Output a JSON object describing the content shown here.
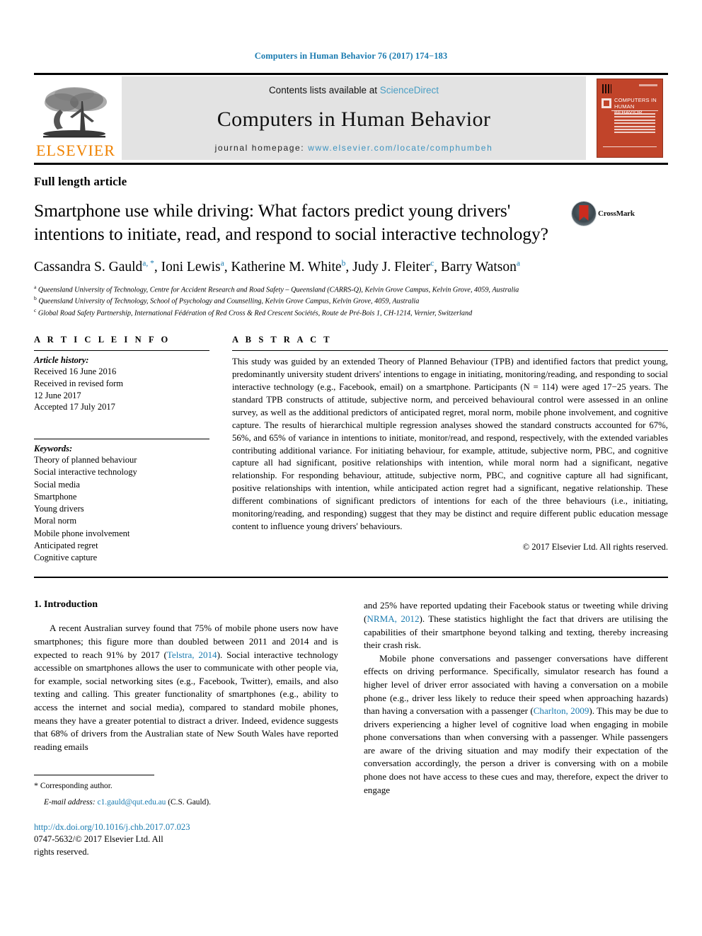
{
  "running_head": "Computers in Human Behavior 76 (2017) 174−183",
  "banner": {
    "publisher_logo_text": "ELSEVIER",
    "contents_prefix": "Contents lists available at ",
    "contents_link": "ScienceDirect",
    "journal_name": "Computers in Human Behavior",
    "homepage_prefix": "journal homepage: ",
    "homepage_url": "www.elsevier.com/locate/comphumbeh",
    "cover_title": "COMPUTERS IN HUMAN BEHAVIOR",
    "cover_color": "#c1442a",
    "link_color": "#3e93bf"
  },
  "article": {
    "type": "Full length article",
    "title": "Smartphone use while driving: What factors predict young drivers' intentions to initiate, read, and respond to social interactive technology?",
    "crossmark_label": "CrossMark"
  },
  "authors": {
    "line": [
      {
        "name": "Cassandra S. Gauld",
        "marks": "a, *"
      },
      {
        "name": "Ioni Lewis",
        "marks": "a"
      },
      {
        "name": "Katherine M. White",
        "marks": "b"
      },
      {
        "name": "Judy J. Fleiter",
        "marks": "c"
      },
      {
        "name": "Barry Watson",
        "marks": "a"
      }
    ],
    "affiliations": [
      {
        "mark": "a",
        "text": "Queensland University of Technology, Centre for Accident Research and Road Safety – Queensland (CARRS-Q), Kelvin Grove Campus, Kelvin Grove, 4059, Australia"
      },
      {
        "mark": "b",
        "text": "Queensland University of Technology, School of Psychology and Counselling, Kelvin Grove Campus, Kelvin Grove, 4059, Australia"
      },
      {
        "mark": "c",
        "text": "Global Road Safety Partnership, International Fédération of Red Cross & Red Crescent Sociétés, Route de Pré-Bois 1, CH-1214, Vernier, Switzerland"
      }
    ]
  },
  "article_info": {
    "heading": "A R T I C L E  I N F O",
    "history_label": "Article history:",
    "history": [
      "Received 16 June 2016",
      "Received in revised form",
      "12 June 2017",
      "Accepted 17 July 2017"
    ],
    "keywords_label": "Keywords:",
    "keywords": [
      "Theory of planned behaviour",
      "Social interactive technology",
      "Social media",
      "Smartphone",
      "Young drivers",
      "Moral norm",
      "Mobile phone involvement",
      "Anticipated regret",
      "Cognitive capture"
    ]
  },
  "abstract": {
    "heading": "A B S T R A C T",
    "text": "This study was guided by an extended Theory of Planned Behaviour (TPB) and identified factors that predict young, predominantly university student drivers' intentions to engage in initiating, monitoring/reading, and responding to social interactive technology (e.g., Facebook, email) on a smartphone. Participants (N = 114) were aged 17−25 years. The standard TPB constructs of attitude, subjective norm, and perceived behavioural control were assessed in an online survey, as well as the additional predictors of anticipated regret, moral norm, mobile phone involvement, and cognitive capture. The results of hierarchical multiple regression analyses showed the standard constructs accounted for 67%, 56%, and 65% of variance in intentions to initiate, monitor/read, and respond, respectively, with the extended variables contributing additional variance. For initiating behaviour, for example, attitude, subjective norm, PBC, and cognitive capture all had significant, positive relationships with intention, while moral norm had a significant, negative relationship. For responding behaviour, attitude, subjective norm, PBC, and cognitive capture all had significant, positive relationships with intention, while anticipated action regret had a significant, negative relationship. These different combinations of significant predictors of intentions for each of the three behaviours (i.e., initiating, monitoring/reading, and responding) suggest that they may be distinct and require different public education message content to influence young drivers' behaviours.",
    "copyright": "© 2017 Elsevier Ltd. All rights reserved."
  },
  "body": {
    "section_title": "1. Introduction",
    "left_para_1_a": "A recent Australian survey found that 75% of mobile phone users now have smartphones; this figure more than doubled between 2011 and 2014 and is expected to reach 91% by 2017 (",
    "left_para_1_ref": "Telstra, 2014",
    "left_para_1_b": "). Social interactive technology accessible on smartphones allows the user to communicate with other people via, for example, social networking sites (e.g., Facebook, Twitter), emails, and also texting and calling. This greater functionality of smartphones (e.g., ability to access the internet and social media), compared to standard mobile phones, means they have a greater potential to distract a driver. Indeed, evidence suggests that 68% of drivers from the Australian state of New South Wales have reported reading emails",
    "right_para_1_a": "and 25% have reported updating their Facebook status or tweeting while driving (",
    "right_para_1_ref": "NRMA, 2012",
    "right_para_1_b": "). These statistics highlight the fact that drivers are utilising the capabilities of their smartphone beyond talking and texting, thereby increasing their crash risk.",
    "right_para_2_a": "Mobile phone conversations and passenger conversations have different effects on driving performance. Specifically, simulator research has found a higher level of driver error associated with having a conversation on a mobile phone (e.g., driver less likely to reduce their speed when approaching hazards) than having a conversation with a passenger (",
    "right_para_2_ref": "Charlton, 2009",
    "right_para_2_b": "). This may be due to drivers experiencing a higher level of cognitive load when engaging in mobile phone conversations than when conversing with a passenger. While passengers are aware of the driving situation and may modify their expectation of the conversation accordingly, the person a driver is conversing with on a mobile phone does not have access to these cues and may, therefore, expect the driver to engage"
  },
  "footnote": {
    "star": "*",
    "corresponding": "Corresponding author.",
    "email_label": "E-mail address:",
    "email": "c1.gauld@qut.edu.au",
    "email_owner": "(C.S. Gauld).",
    "doi": "http://dx.doi.org/10.1016/j.chb.2017.07.023",
    "issn": "0747-5632/© 2017 Elsevier Ltd. All rights reserved."
  }
}
